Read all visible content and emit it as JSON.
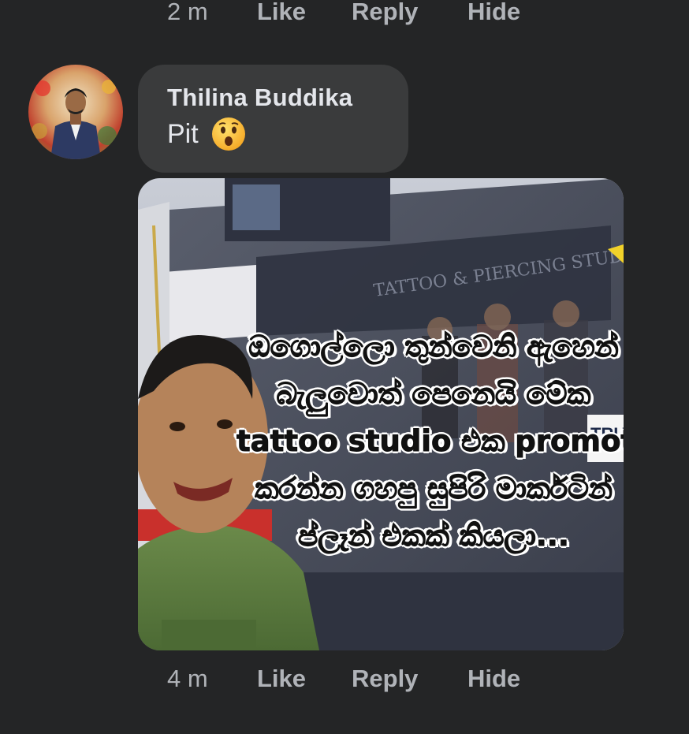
{
  "previous_comment": {
    "time": "2 m",
    "like_label": "Like",
    "reply_label": "Reply",
    "hide_label": "Hide"
  },
  "comment": {
    "author": "Thilina Buddika",
    "text": "Pit",
    "emoji": "hushed-face-emoji",
    "attachment": {
      "type": "meme-image",
      "caption_lines": [
        "ඔගොල්ලො තුන්වෙනි ඇහෙන්",
        "බැලුවොත් පෙනෙයි මේක",
        "tattoo studio එක promote",
        "කරන්න ගහපු සුපිරි මාර්කටින්",
        "ප්ලෑන් එකක් කියලා..."
      ],
      "background_sign": "TATTOO & PIERCING STUDIO",
      "partial_sign_text": "TRU"
    },
    "time": "4 m",
    "like_label": "Like",
    "reply_label": "Reply",
    "hide_label": "Hide"
  },
  "colors": {
    "background": "#242526",
    "bubble": "#3a3b3c",
    "primary_text": "#e4e6eb",
    "secondary_text": "#b0b3b8"
  }
}
